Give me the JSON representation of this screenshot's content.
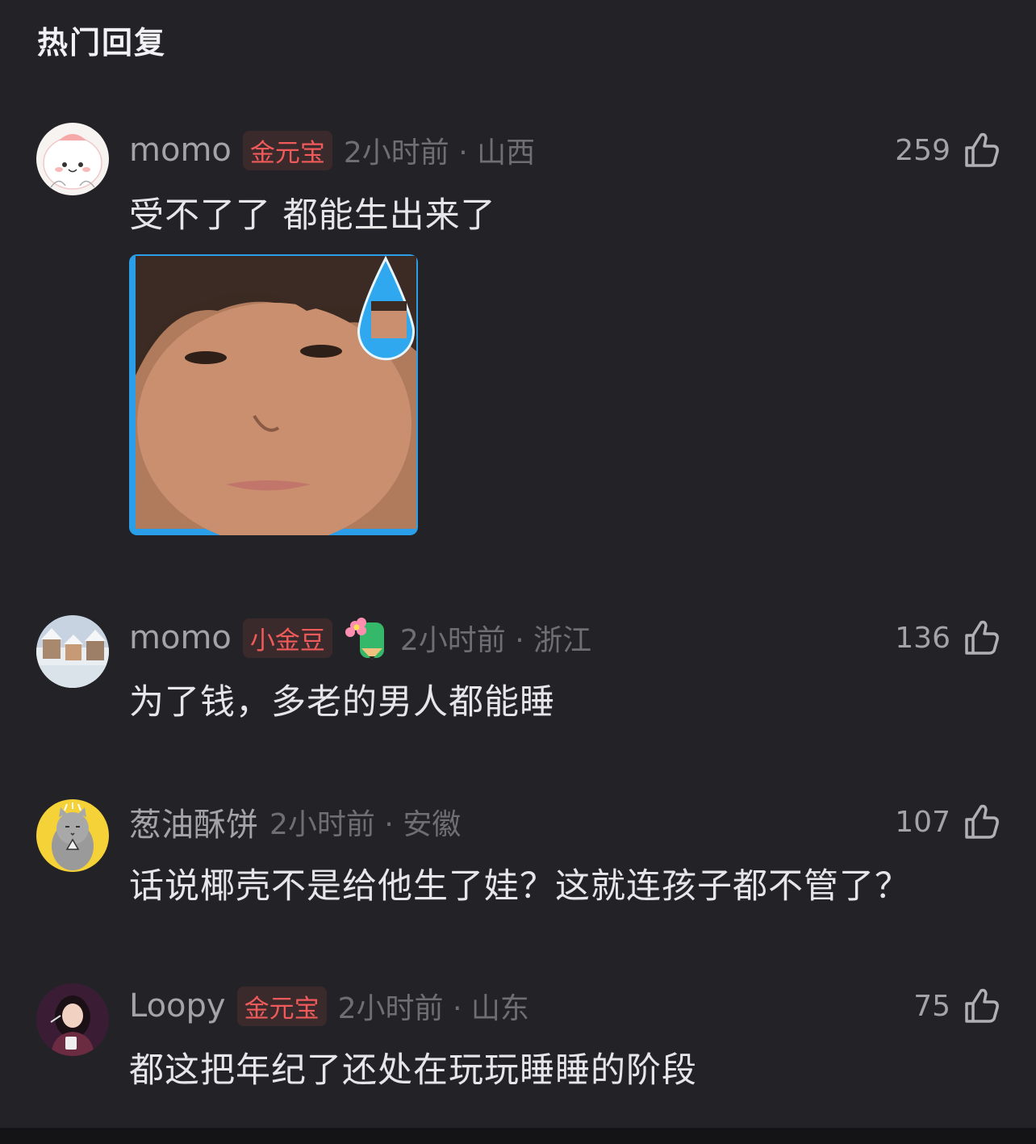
{
  "section": {
    "title": "热门回复"
  },
  "comments": [
    {
      "username": "momo",
      "badge": "金元宝",
      "time": "2小时前 · 山西",
      "likes": "259",
      "content": "受不了了 都能生出来了",
      "avatar_icon": "cartoon-face-avatar",
      "has_image": true
    },
    {
      "username": "momo",
      "badge": "小金豆",
      "emoji_badge": "pencil-flower-icon",
      "time": "2小时前 · 浙江",
      "likes": "136",
      "content": "为了钱，多老的男人都能睡",
      "avatar_icon": "snowy-town-avatar"
    },
    {
      "username": "葱油酥饼",
      "time": "2小时前 · 安徽",
      "likes": "107",
      "content": "话说椰壳不是给他生了娃？这就连孩子都不管了？",
      "avatar_icon": "cat-praying-avatar"
    },
    {
      "username": "Loopy",
      "badge": "金元宝",
      "time": "2小时前 · 山东",
      "likes": "75",
      "content": "都这把年纪了还处在玩玩睡睡的阶段",
      "avatar_icon": "girl-photo-avatar"
    }
  ],
  "colors": {
    "background": "#232327",
    "badge_text": "#f05a5a",
    "badge_bg": "#3a2a2c",
    "meta_text": "#6e6e74"
  }
}
